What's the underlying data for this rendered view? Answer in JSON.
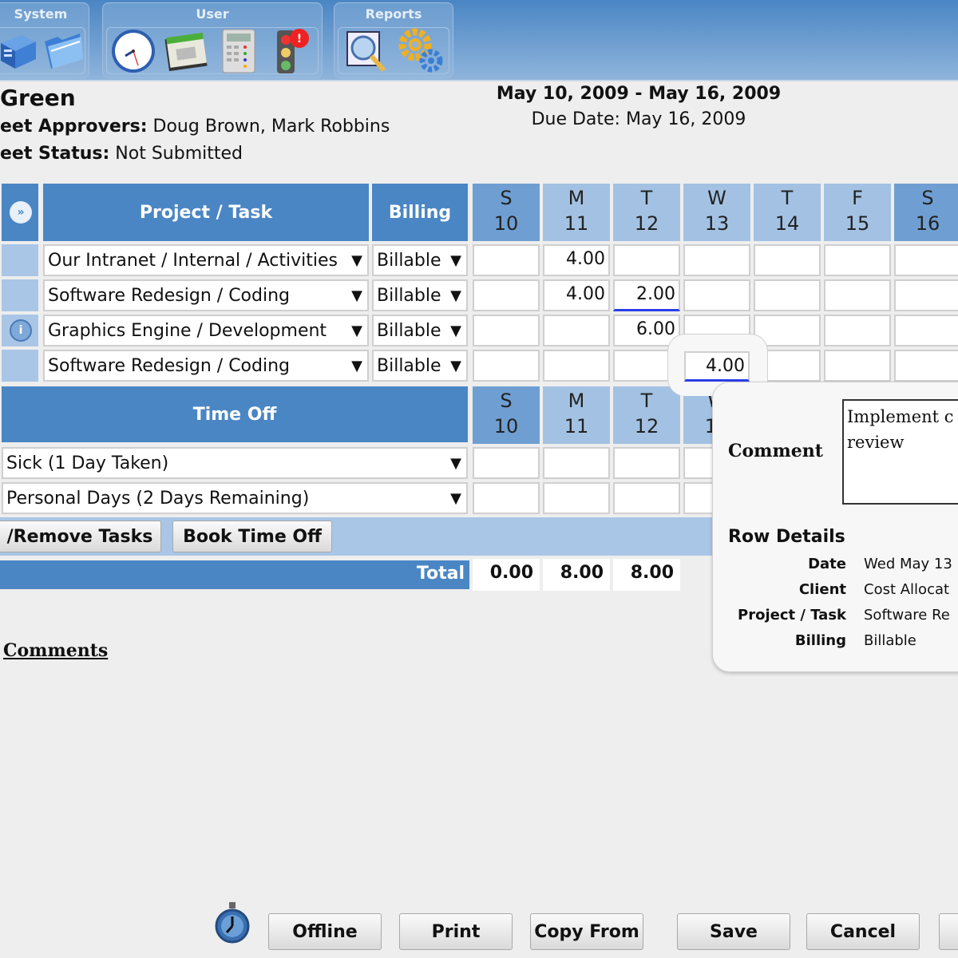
{
  "toolbar": {
    "groups": [
      {
        "title": "System",
        "icons": [
          "server-icon",
          "folder-icon"
        ]
      },
      {
        "title": "User",
        "icons": [
          "clock-icon",
          "calendar-icon",
          "calculator-icon",
          "traffic-light-alert-icon"
        ]
      },
      {
        "title": "Reports",
        "icons": [
          "report-search-icon",
          "gears-icon"
        ]
      }
    ]
  },
  "header": {
    "employee_name": "Green",
    "approvers_label": "eet Approvers:",
    "approvers_value": "Doug Brown, Mark Robbins",
    "status_label": "eet Status:",
    "status_value": "Not Submitted",
    "date_range": "May 10, 2009 - May 16, 2009",
    "due_date": "Due Date: May 16, 2009"
  },
  "grid": {
    "project_header": "Project / Task",
    "billing_header": "Billing",
    "days": [
      {
        "letter": "S",
        "num": "10",
        "weekend": true
      },
      {
        "letter": "M",
        "num": "11",
        "weekend": false
      },
      {
        "letter": "T",
        "num": "12",
        "weekend": false
      },
      {
        "letter": "W",
        "num": "13",
        "weekend": false
      },
      {
        "letter": "T",
        "num": "14",
        "weekend": false
      },
      {
        "letter": "F",
        "num": "15",
        "weekend": false
      },
      {
        "letter": "S",
        "num": "16",
        "weekend": true
      }
    ],
    "rows": [
      {
        "task": "Our Intranet / Internal / Activities",
        "billing": "Billable",
        "hours": [
          "",
          "4.00",
          "",
          "",
          "",
          "",
          ""
        ],
        "info_icon": false
      },
      {
        "task": "Software Redesign / Coding",
        "billing": "Billable",
        "hours": [
          "",
          "4.00",
          "2.00",
          "",
          "",
          "",
          ""
        ],
        "info_icon": false
      },
      {
        "task": "Graphics Engine / Development",
        "billing": "Billable",
        "hours": [
          "",
          "",
          "6.00",
          "",
          "",
          "",
          ""
        ],
        "info_icon": true
      },
      {
        "task": "Software Redesign / Coding",
        "billing": "Billable",
        "hours": [
          "",
          "",
          "",
          "4.00",
          "",
          "",
          ""
        ],
        "info_icon": false
      }
    ],
    "time_off_header": "Time Off",
    "time_off_rows": [
      {
        "type": "Sick (1 Day Taken)"
      },
      {
        "type": "Personal Days (2 Days Remaining)"
      }
    ],
    "add_remove_label": "/Remove Tasks",
    "book_time_off_label": "Book Time Off",
    "total_label": "Total",
    "totals": [
      "0.00",
      "8.00",
      "8.00"
    ]
  },
  "popup": {
    "comment_label": "Comment",
    "comment_value": "Implement c\nreview",
    "row_details_label": "Row Details",
    "details": [
      {
        "key": "Date",
        "value": "Wed May 13"
      },
      {
        "key": "Client",
        "value": "Cost Allocat"
      },
      {
        "key": "Project / Task",
        "value": "Software Re"
      },
      {
        "key": "Billing",
        "value": "Billable"
      }
    ]
  },
  "comments_link": "Comments",
  "footer": {
    "buttons": [
      "Offline",
      "Print",
      "Copy From",
      "Save",
      "Cancel",
      ""
    ]
  }
}
